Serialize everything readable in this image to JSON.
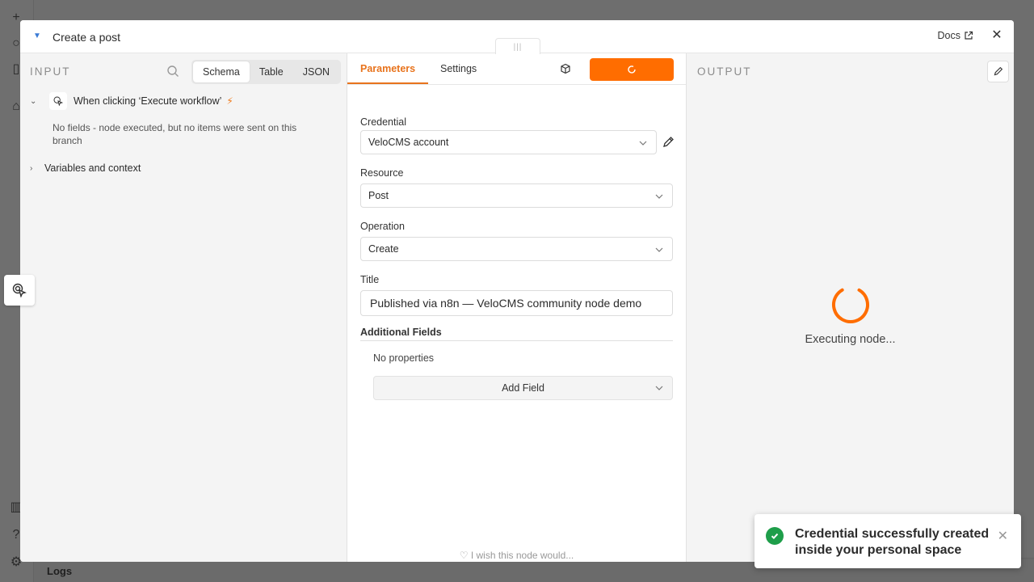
{
  "header": {
    "title": "Create a post",
    "docs_label": "Docs",
    "close_symbol": "✕"
  },
  "input_panel": {
    "label": "INPUT",
    "tabs": [
      "Schema",
      "Table",
      "JSON"
    ],
    "active_tab": "Schema",
    "trigger_node": "When clicking ‘Execute workflow’",
    "empty_message": "No fields - node executed, but no items were sent on this branch",
    "variables_row": "Variables and context"
  },
  "params_panel": {
    "tabs": {
      "parameters": "Parameters",
      "settings": "Settings"
    },
    "credential": {
      "label": "Credential",
      "value": "VeloCMS account"
    },
    "resource": {
      "label": "Resource",
      "value": "Post"
    },
    "operation": {
      "label": "Operation",
      "value": "Create"
    },
    "title_field": {
      "label": "Title",
      "value": "Published via n8n — VeloCMS community node demo"
    },
    "additional_fields": {
      "label": "Additional Fields",
      "empty": "No properties",
      "add_button": "Add Field"
    },
    "wish_text": "I wish this node would..."
  },
  "output_panel": {
    "label": "OUTPUT",
    "status": "Executing node..."
  },
  "toast": {
    "message": "Credential successfully created inside your personal space",
    "close_symbol": "✕"
  },
  "background": {
    "logs_label": "Logs"
  },
  "colors": {
    "accent": "#ff6d00",
    "tab_accent": "#e8731c",
    "success": "#1e9e4a"
  }
}
